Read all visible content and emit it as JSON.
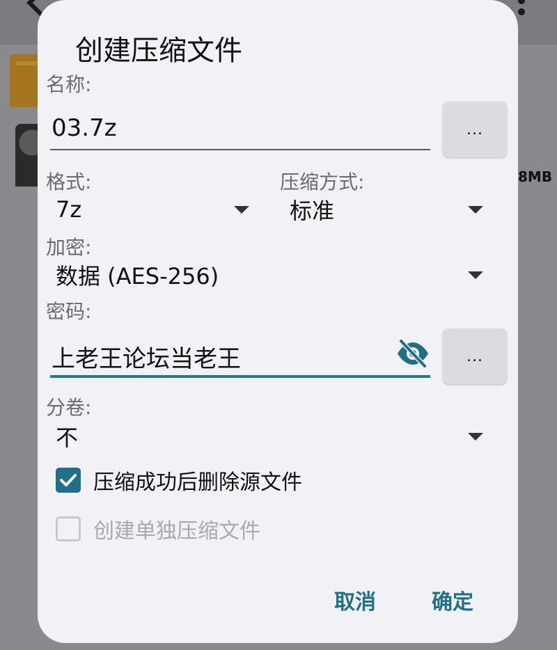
{
  "background": {
    "file_size": "8MB"
  },
  "dialog": {
    "title": "创建压缩文件",
    "name": {
      "label": "名称:",
      "value": "03.7z",
      "browse_label": "..."
    },
    "format": {
      "label": "格式:",
      "value": "7z"
    },
    "method": {
      "label": "压缩方式:",
      "value": "标准"
    },
    "encryption": {
      "label": "加密:",
      "value": "数据 (AES-256)"
    },
    "password": {
      "label": "密码:",
      "value": "上老王论坛当老王",
      "more_label": "...",
      "visibility_icon": "eye-off-icon"
    },
    "volume": {
      "label": "分卷:",
      "value": "不"
    },
    "delete_source": {
      "label": "压缩成功后删除源文件",
      "checked": true
    },
    "separate_archives": {
      "label": "创建单独压缩文件",
      "checked": false,
      "enabled": false
    },
    "actions": {
      "cancel": "取消",
      "ok": "确定"
    }
  },
  "colors": {
    "accent": "#1f6f86",
    "dialog_bg": "#f2f1f6",
    "scrim": "#8a8a8e"
  }
}
